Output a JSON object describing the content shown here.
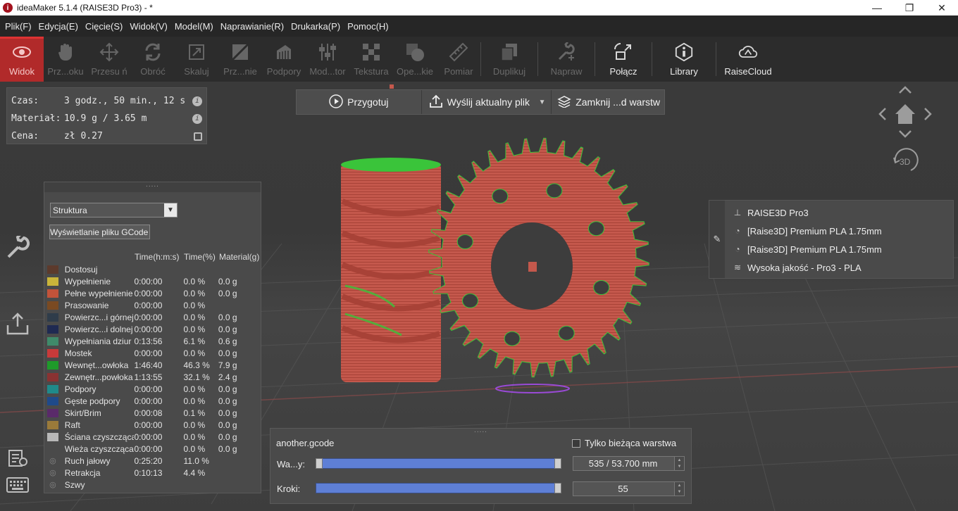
{
  "window": {
    "title": "ideaMaker 5.1.4 (RAISE3D Pro3) - *",
    "app_icon_letter": "i",
    "minimize": "—",
    "restore": "❐",
    "close": "✕"
  },
  "menu": [
    "Plik(F)",
    "Edycja(E)",
    "Cięcie(S)",
    "Widok(V)",
    "Model(M)",
    "Naprawianie(R)",
    "Drukarka(P)",
    "Pomoc(H)"
  ],
  "toolbar": {
    "items": [
      {
        "label": "Widok",
        "icon": "eye-icon",
        "state": "active"
      },
      {
        "label": "Prz...oku",
        "icon": "hand-icon",
        "state": "disabled"
      },
      {
        "label": "Przesu ń",
        "icon": "move-icon",
        "state": "disabled"
      },
      {
        "label": "Obróć",
        "icon": "rotate-icon",
        "state": "disabled"
      },
      {
        "label": "Skaluj",
        "icon": "scale-icon",
        "state": "disabled"
      },
      {
        "label": "Prz...nie",
        "icon": "cut-icon",
        "state": "disabled"
      },
      {
        "label": "Podpory",
        "icon": "supports-icon",
        "state": "disabled"
      },
      {
        "label": "Mod...tor",
        "icon": "modifier-icon",
        "state": "disabled"
      },
      {
        "label": "Tekstura",
        "icon": "texture-icon",
        "state": "disabled"
      },
      {
        "label": "Ope...kie",
        "icon": "boolean-icon",
        "state": "disabled"
      },
      {
        "label": "Pomiar",
        "icon": "ruler-icon",
        "state": "disabled"
      },
      {
        "label": "Duplikuj",
        "icon": "duplicate-icon",
        "state": "disabled"
      },
      {
        "label": "Napraw",
        "icon": "wrench-plus-icon",
        "state": "disabled"
      },
      {
        "label": "Połącz",
        "icon": "connect-icon",
        "state": "enabled"
      },
      {
        "label": "Library",
        "icon": "library-icon",
        "state": "enabled"
      },
      {
        "label": "RaiseCloud",
        "icon": "cloud-icon",
        "state": "enabled"
      }
    ]
  },
  "info": {
    "time_label": "Czas:",
    "time_value": "3 godz., 50 min., 12 s",
    "material_label": "Materiał:",
    "material_value": "10.9 g / 3.65 m",
    "price_label": "Cena:",
    "price_value": "zł 0.27"
  },
  "actions": {
    "prepare": "Przygotuj",
    "send": "Wyślij aktualny plik",
    "close_layer": "Zamknij ...d warstw"
  },
  "view_controls": {
    "label_3d": "3D"
  },
  "profile": {
    "printer": "RAISE3D Pro3",
    "filament_left": "[Raise3D] Premium PLA 1.75mm",
    "filament_right": "[Raise3D] Premium PLA 1.75mm",
    "quality": "Wysoka jakość - Pro3 - PLA"
  },
  "structure": {
    "dropdown": "Struktura",
    "gcode_button": "Wyświetlanie pliku GCode",
    "headers": {
      "time": "Time(h:m:s)",
      "percent": "Time(%)",
      "material": "Material(g)"
    },
    "rows": [
      {
        "name": "Dostosuj",
        "time": "",
        "pct": "",
        "mat": "",
        "color": "#5c3a2c",
        "eye": false
      },
      {
        "name": "Wypełnienie",
        "time": "0:00:00",
        "pct": "0.0 %",
        "mat": "0.0 g",
        "color": "#c9b43a",
        "eye": false
      },
      {
        "name": "Pełne wypełnienie",
        "time": "0:00:00",
        "pct": "0.0 %",
        "mat": "0.0 g",
        "color": "#c2533a",
        "eye": false
      },
      {
        "name": "Prasowanie",
        "time": "0:00:00",
        "pct": "0.0 %",
        "mat": "",
        "color": "#7a4a22",
        "eye": false
      },
      {
        "name": "Powierzc...i górnej",
        "time": "0:00:00",
        "pct": "0.0 %",
        "mat": "0.0 g",
        "color": "#2f3c4a",
        "eye": false
      },
      {
        "name": "Powierzc...i dolnej",
        "time": "0:00:00",
        "pct": "0.0 %",
        "mat": "0.0 g",
        "color": "#1f2a52",
        "eye": false
      },
      {
        "name": "Wypełniania dziur",
        "time": "0:13:56",
        "pct": "6.1 %",
        "mat": "0.6 g",
        "color": "#3f8a6a",
        "eye": false
      },
      {
        "name": "Mostek",
        "time": "0:00:00",
        "pct": "0.0 %",
        "mat": "0.0 g",
        "color": "#c83a3a",
        "eye": false
      },
      {
        "name": "Wewnęt...owłoka",
        "time": "1:46:40",
        "pct": "46.3 %",
        "mat": "7.9 g",
        "color": "#1f9a2a",
        "eye": false
      },
      {
        "name": "Zewnętr...powłoka",
        "time": "1:13:55",
        "pct": "32.1 %",
        "mat": "2.4 g",
        "color": "#8a3232",
        "eye": false
      },
      {
        "name": "Podpory",
        "time": "0:00:00",
        "pct": "0.0 %",
        "mat": "0.0 g",
        "color": "#1f8a8a",
        "eye": false
      },
      {
        "name": "Gęste podpory",
        "time": "0:00:00",
        "pct": "0.0 %",
        "mat": "0.0 g",
        "color": "#1f4a8a",
        "eye": false
      },
      {
        "name": "Skirt/Brim",
        "time": "0:00:08",
        "pct": "0.1 %",
        "mat": "0.0 g",
        "color": "#5a2a6a",
        "eye": false
      },
      {
        "name": "Raft",
        "time": "0:00:00",
        "pct": "0.0 %",
        "mat": "0.0 g",
        "color": "#9a7a3a",
        "eye": false
      },
      {
        "name": "Ściana czyszcząca",
        "time": "0:00:00",
        "pct": "0.0 %",
        "mat": "0.0 g",
        "color": "#b8b8b8",
        "eye": false
      },
      {
        "name": "Wieża czyszcząca",
        "time": "0:00:00",
        "pct": "0.0 %",
        "mat": "0.0 g",
        "color": "#4a4a4a",
        "eye": false
      },
      {
        "name": "Ruch jałowy",
        "time": "0:25:20",
        "pct": "11.0 %",
        "mat": "",
        "color": "",
        "eye": true
      },
      {
        "name": "Retrakcja",
        "time": "0:10:13",
        "pct": "4.4 %",
        "mat": "",
        "color": "",
        "eye": true
      },
      {
        "name": "Szwy",
        "time": "",
        "pct": "",
        "mat": "",
        "color": "",
        "eye": true
      }
    ]
  },
  "layers": {
    "filename": "another.gcode",
    "current_only": "Tylko bieżąca warstwa",
    "layer_label": "Wa...y:",
    "layer_value": "535 / 53.700 mm",
    "layer_fill": 1.0,
    "steps_label": "Kroki:",
    "steps_value": "55",
    "steps_fill": 1.0
  },
  "colors": {
    "accent_active": "#b12a2a",
    "model_outer": "#c4584c",
    "model_inner": "#2fc02f",
    "slider_blue": "#5e7fd6"
  }
}
